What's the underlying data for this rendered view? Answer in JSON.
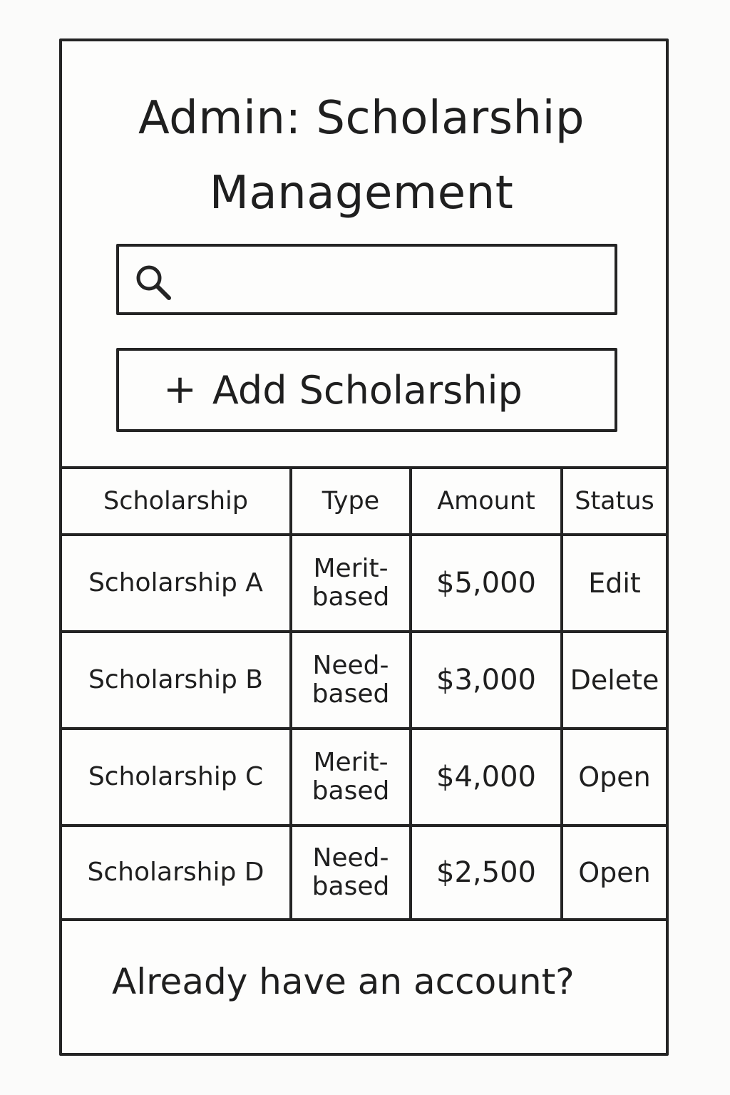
{
  "page": {
    "title_line_1": "Admin: Scholarship",
    "title_line_2": "Management"
  },
  "search": {
    "icon": "search-icon",
    "value": "",
    "placeholder": ""
  },
  "toolbar": {
    "add_icon": "plus-icon",
    "add_label": "Add Scholarship"
  },
  "table": {
    "columns": [
      "Scholarship",
      "Type",
      "Amount",
      "Status"
    ],
    "rows": [
      {
        "name": "Scholarship A",
        "type_line_1": "Merit-",
        "type_line_2": "based",
        "amount": "$5,000",
        "status": "Edit"
      },
      {
        "name": "Scholarship B",
        "type_line_1": "Need-",
        "type_line_2": "based",
        "amount": "$3,000",
        "status": "Delete"
      },
      {
        "name": "Scholarship C",
        "type_line_1": "Merit-",
        "type_line_2": "based",
        "amount": "$4,000",
        "status": "Open"
      },
      {
        "name": "Scholarship D",
        "type_line_1": "Need-",
        "type_line_2": "based",
        "amount": "$2,500",
        "status": "Open"
      }
    ]
  },
  "footer": {
    "account_prompt": "Already have an account?"
  },
  "colors": {
    "ink": "#242424",
    "background": "#fbfbfa"
  }
}
